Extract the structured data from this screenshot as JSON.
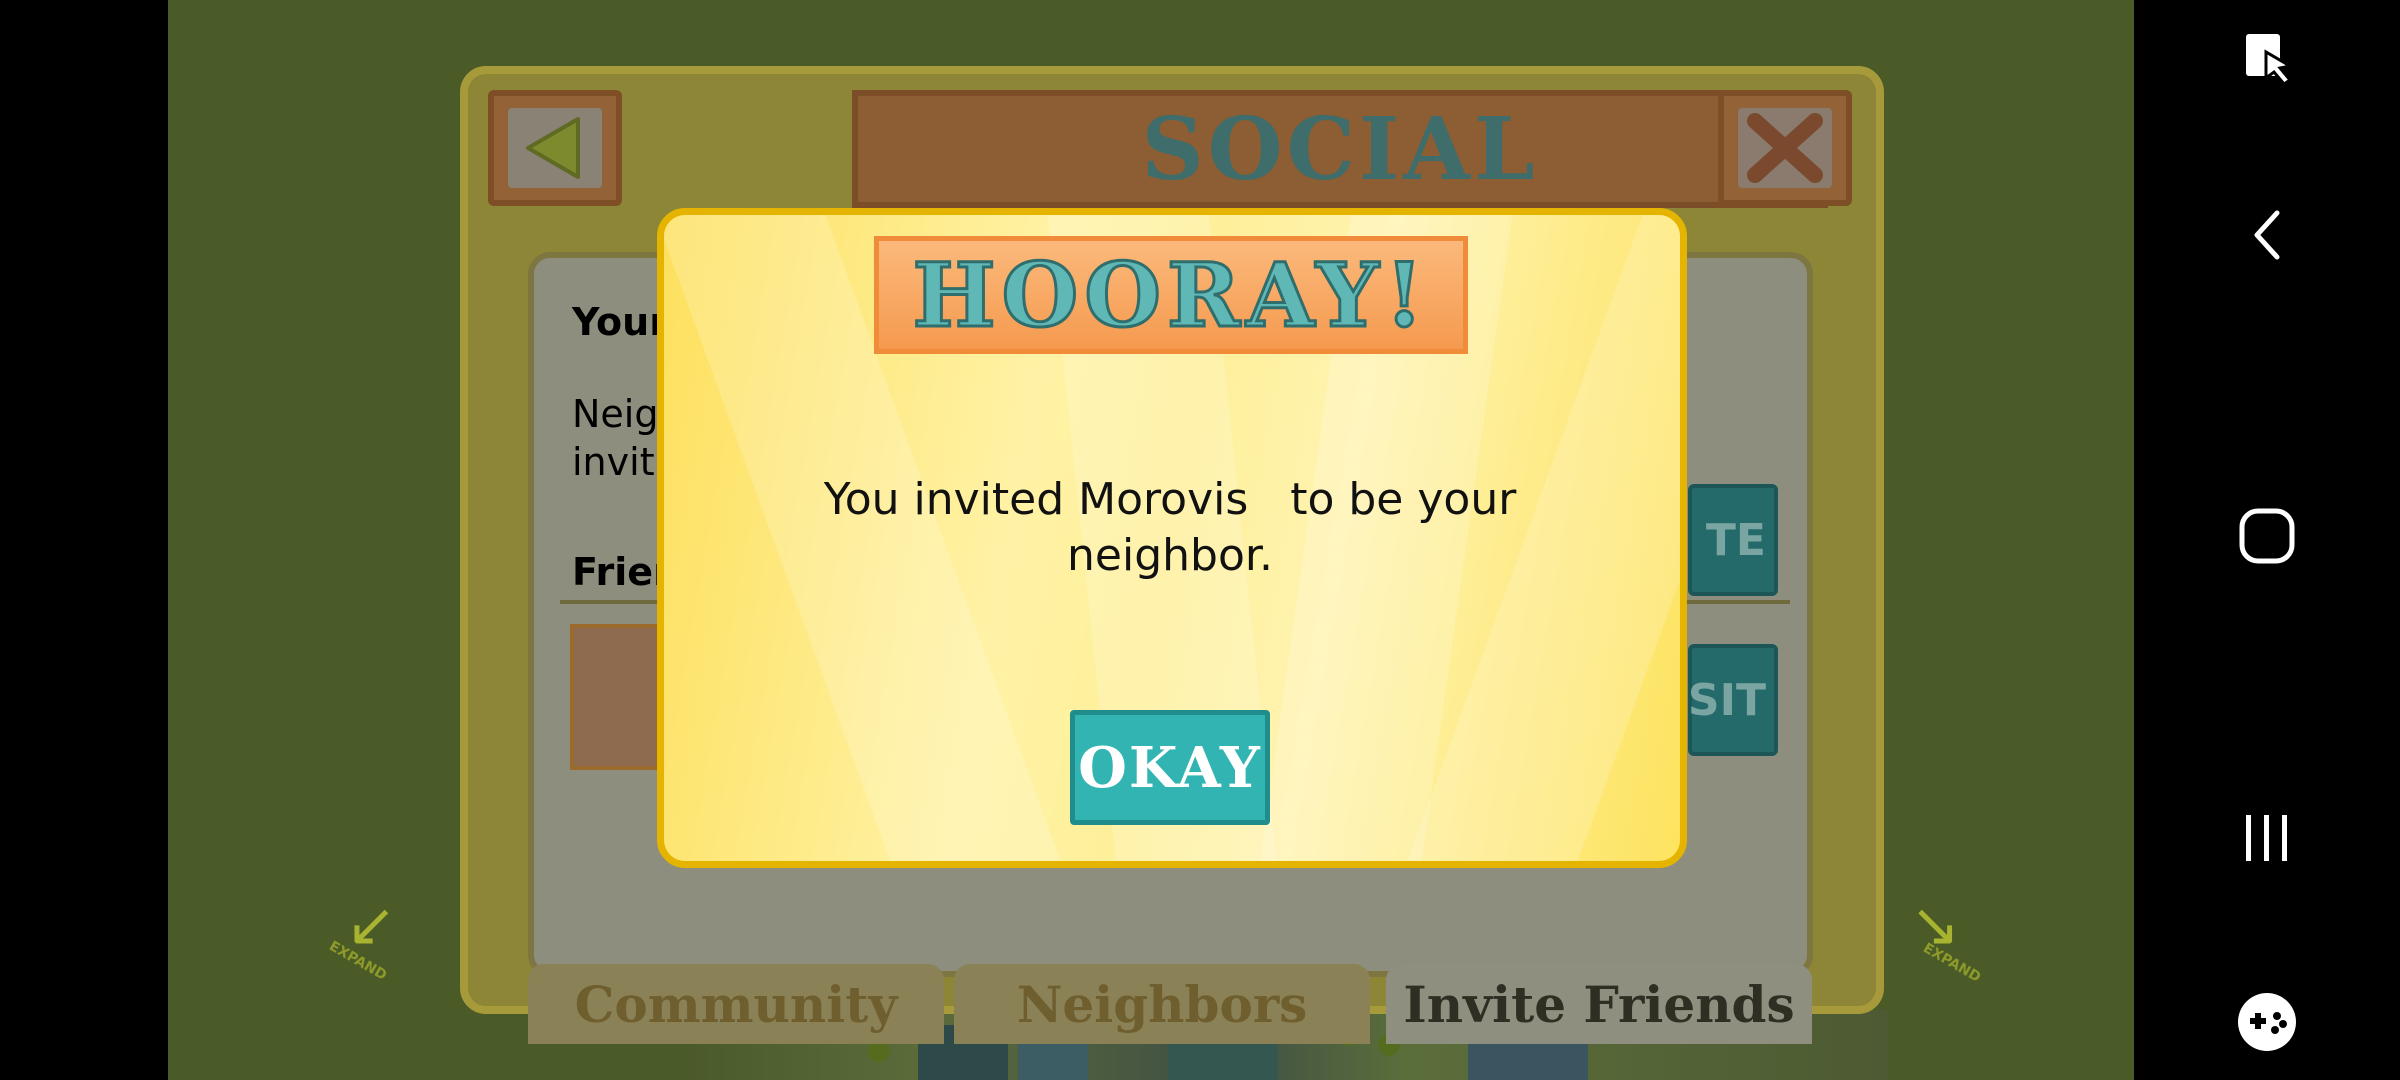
{
  "social_panel": {
    "title": "SOCIAL",
    "back_icon": "triangle-left-icon",
    "close_icon": "x-close-icon",
    "your_label_partial": "Your",
    "neighbors_text_line1": "Neig",
    "neighbors_text_line2": "invit",
    "friends_label_partial": "Frien",
    "invite_button_partial": "TE",
    "visit_button_partial": "SIT",
    "tabs": [
      {
        "label": "Community"
      },
      {
        "label": "Neighbors"
      },
      {
        "label": "Invite Friends"
      }
    ],
    "expand_label": "EXPAND"
  },
  "modal": {
    "title": "HOORAY!",
    "message": "You invited Morovis   to be your\nneighbor.",
    "okay_label": "OKAY"
  },
  "navbar": {
    "icons": [
      "screen-lock-icon",
      "back-icon",
      "home-icon",
      "recents-icon",
      "game-controller-icon"
    ]
  },
  "colors": {
    "modal_border": "#e4b400",
    "okay_button": "#31b4b2",
    "banner": "#f59a4f"
  }
}
